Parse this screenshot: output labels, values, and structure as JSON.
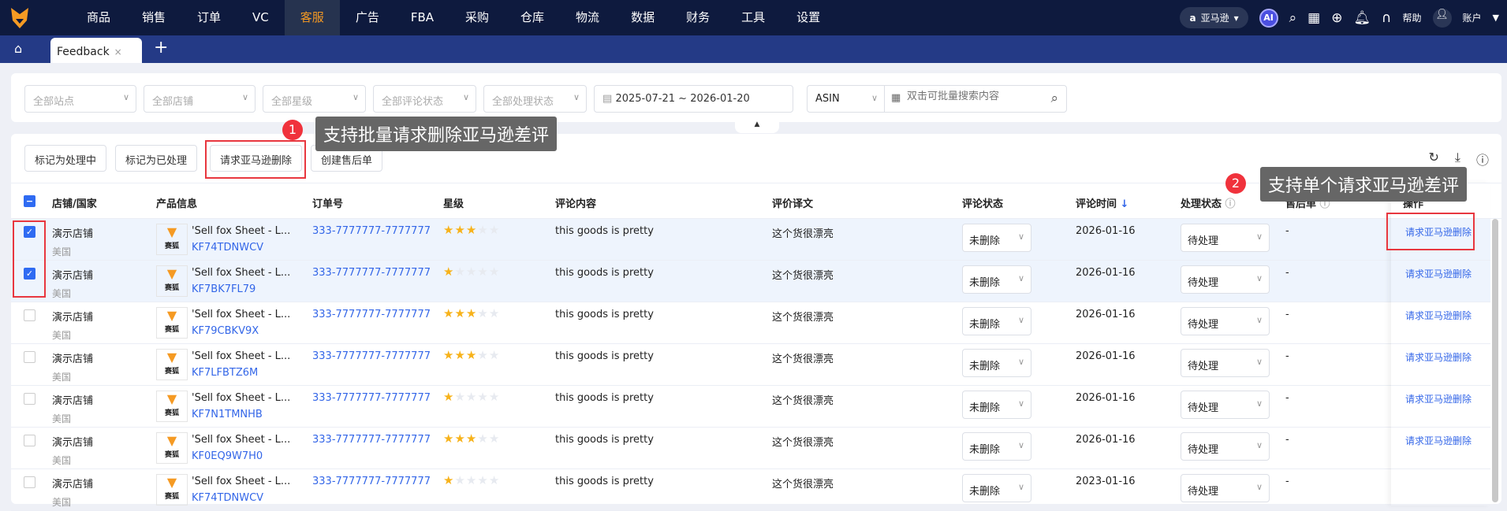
{
  "nav": {
    "items": [
      "商品",
      "销售",
      "订单",
      "VC",
      "客服",
      "广告",
      "FBA",
      "采购",
      "仓库",
      "物流",
      "数据",
      "财务",
      "工具",
      "设置"
    ],
    "active": "客服",
    "marketplace": "亚马逊",
    "ai": "AI",
    "help": "帮助",
    "account": "账户"
  },
  "tabs": {
    "current": "Feedback",
    "close": "×",
    "add": "+"
  },
  "filters": {
    "site": "全部站点",
    "store": "全部店铺",
    "rating": "全部星级",
    "review_status": "全部评论状态",
    "process_status": "全部处理状态",
    "date_start": "2025-07-21",
    "date_sep": "~",
    "date_end": "2026-01-20",
    "search_type": "ASIN",
    "search_placeholder": "双击可批量搜索内容"
  },
  "toolbar": {
    "mark_processing": "标记为处理中",
    "mark_processed": "标记为已处理",
    "request_delete": "请求亚马逊删除",
    "create_aftersale": "创建售后单"
  },
  "columns": {
    "store": "店铺/国家",
    "product": "产品信息",
    "order": "订单号",
    "rating": "星级",
    "content": "评论内容",
    "translation": "评价译文",
    "review_status": "评论状态",
    "review_time": "评论时间",
    "sort": "↓",
    "process_status": "处理状态",
    "aftersale": "售后单",
    "action": "操作"
  },
  "rows": [
    {
      "checked": true,
      "store": "演示店铺",
      "country": "美国",
      "title": "'Sell fox Sheet - L...",
      "sku": "KF74TDNWCV",
      "order": "333-7777777-7777777",
      "stars": 3,
      "content": "this goods is pretty",
      "translation": "这个货很漂亮",
      "review_status": "未删除",
      "time": "2026-01-16",
      "process": "待处理",
      "aftersale": "-",
      "action": "请求亚马逊删除"
    },
    {
      "checked": true,
      "store": "演示店铺",
      "country": "美国",
      "title": "'Sell fox Sheet - L...",
      "sku": "KF7BK7FL79",
      "order": "333-7777777-7777777",
      "stars": 1,
      "content": "this goods is pretty",
      "translation": "这个货很漂亮",
      "review_status": "未删除",
      "time": "2026-01-16",
      "process": "待处理",
      "aftersale": "-",
      "action": "请求亚马逊删除"
    },
    {
      "checked": false,
      "store": "演示店铺",
      "country": "美国",
      "title": "'Sell fox Sheet - L...",
      "sku": "KF79CBKV9X",
      "order": "333-7777777-7777777",
      "stars": 3,
      "content": "this goods is pretty",
      "translation": "这个货很漂亮",
      "review_status": "未删除",
      "time": "2026-01-16",
      "process": "待处理",
      "aftersale": "-",
      "action": "请求亚马逊删除"
    },
    {
      "checked": false,
      "store": "演示店铺",
      "country": "美国",
      "title": "'Sell fox Sheet - L...",
      "sku": "KF7LFBTZ6M",
      "order": "333-7777777-7777777",
      "stars": 3,
      "content": "this goods is pretty",
      "translation": "这个货很漂亮",
      "review_status": "未删除",
      "time": "2026-01-16",
      "process": "待处理",
      "aftersale": "-",
      "action": "请求亚马逊删除"
    },
    {
      "checked": false,
      "store": "演示店铺",
      "country": "美国",
      "title": "'Sell fox Sheet - L...",
      "sku": "KF7N1TMNHB",
      "order": "333-7777777-7777777",
      "stars": 1,
      "content": "this goods is pretty",
      "translation": "这个货很漂亮",
      "review_status": "未删除",
      "time": "2026-01-16",
      "process": "待处理",
      "aftersale": "-",
      "action": "请求亚马逊删除"
    },
    {
      "checked": false,
      "store": "演示店铺",
      "country": "美国",
      "title": "'Sell fox Sheet - L...",
      "sku": "KF0EQ9W7H0",
      "order": "333-7777777-7777777",
      "stars": 3,
      "content": "this goods is pretty",
      "translation": "这个货很漂亮",
      "review_status": "未删除",
      "time": "2026-01-16",
      "process": "待处理",
      "aftersale": "-",
      "action": "请求亚马逊删除"
    },
    {
      "checked": false,
      "store": "演示店铺",
      "country": "美国",
      "title": "'Sell fox Sheet - L...",
      "sku": "KF74TDNWCV",
      "order": "333-7777777-7777777",
      "stars": 1,
      "content": "this goods is pretty",
      "translation": "这个货很漂亮",
      "review_status": "未删除",
      "time": "2023-01-16",
      "process": "待处理",
      "aftersale": "-",
      "action": ""
    }
  ],
  "product_logo": "赛狐",
  "callouts": [
    {
      "num": "1",
      "text": "支持批量请求删除亚马逊差评"
    },
    {
      "num": "2",
      "text": "支持单个请求亚马逊差评"
    }
  ],
  "colors": {
    "nav_bg": "#0e1a3e",
    "tabbar_bg": "#243a86",
    "accent": "#f59a23",
    "link": "#3366e8",
    "highlight": "#e8373f"
  }
}
